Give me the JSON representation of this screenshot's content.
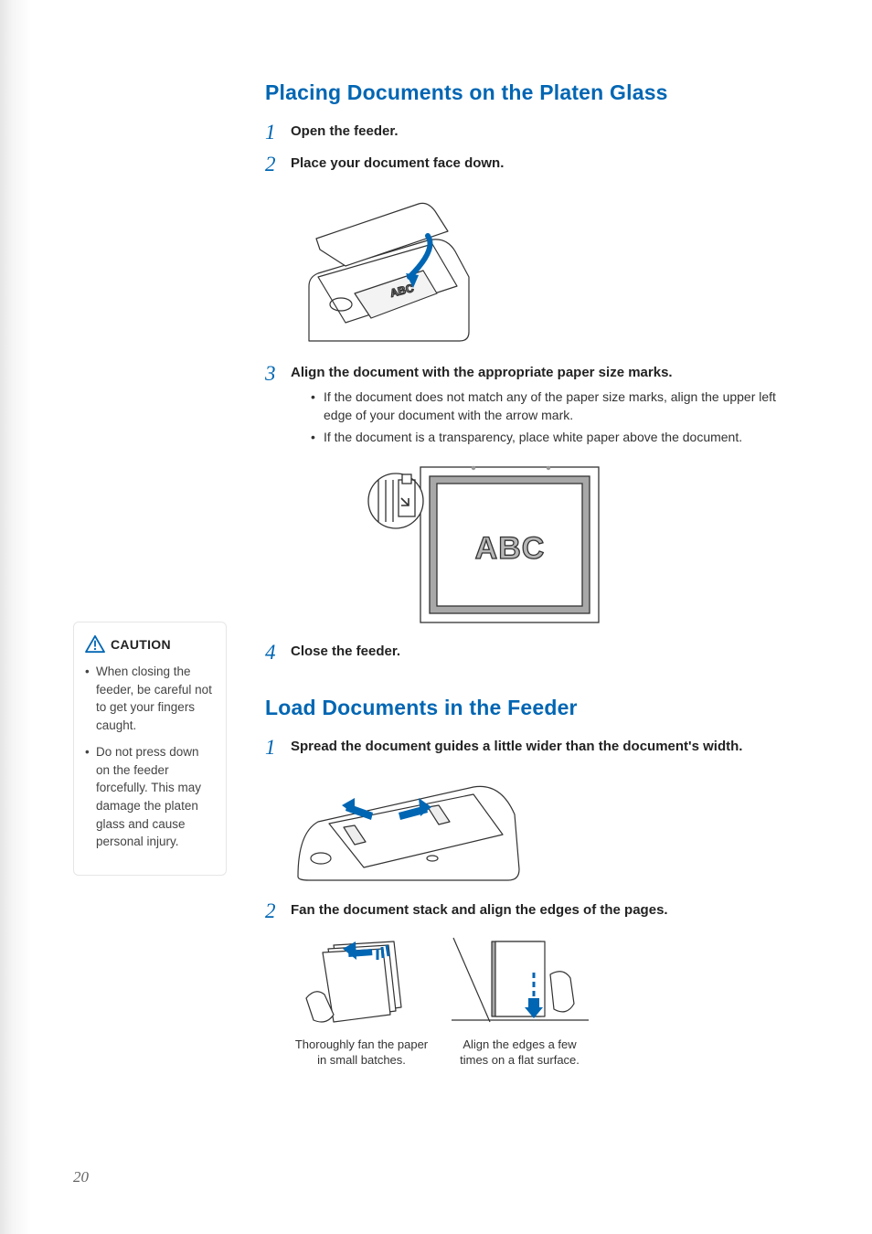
{
  "page_number": "20",
  "section_a": {
    "title": "Placing Documents on the Platen Glass",
    "steps": [
      {
        "num": "1",
        "title": "Open the feeder."
      },
      {
        "num": "2",
        "title": "Place your document face down."
      },
      {
        "num": "3",
        "title": "Align the document with the appropriate paper size marks.",
        "bullets": [
          "If the document does not match any of the paper size marks, align the upper left edge of your document with the arrow mark.",
          "If the document is a transparency, place white paper above the document."
        ]
      },
      {
        "num": "4",
        "title": "Close the feeder."
      }
    ],
    "illus2_text": "ABC"
  },
  "section_b": {
    "title": "Load Documents in the Feeder",
    "steps": [
      {
        "num": "1",
        "title": "Spread the document guides a little wider than the document's width."
      },
      {
        "num": "2",
        "title": "Fan the document stack and align the edges of the pages."
      }
    ],
    "captions": {
      "fan": "Thoroughly fan the paper in small batches.",
      "align": "Align the edges a few times on a flat surface."
    }
  },
  "caution": {
    "label": "CAUTION",
    "bullets": [
      "When closing the feeder, be careful not to get your fingers caught.",
      "Do not press down on the feeder forcefully. This may damage the platen glass and cause personal injury."
    ]
  }
}
